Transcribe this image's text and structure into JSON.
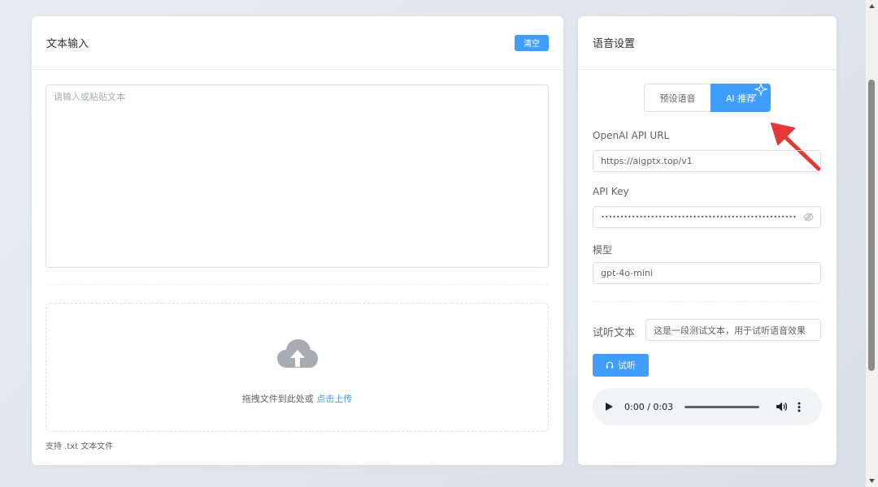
{
  "text_input": {
    "title": "文本输入",
    "clear_label": "清空",
    "placeholder": "请输入或粘贴文本",
    "upload_text": "拖拽文件到此处或 ",
    "upload_link": "点击上传",
    "upload_tip": "支持 .txt 文本文件"
  },
  "voice_settings": {
    "title": "语音设置",
    "segment": {
      "preset_label": "预设语音",
      "ai_label": "AI 推荐",
      "selected": "AI 推荐"
    },
    "api_url_label": "OpenAI API URL",
    "api_url_value": "https://aigptx.top/v1",
    "api_key_label": "API Key",
    "api_key_value": "•••••••••••••••••••••••••••••••••••••••••••••••••••",
    "model_label": "模型",
    "model_value": "gpt-4o-mini",
    "trial_label": "试听文本",
    "trial_value": "这是一段测试文本，用于试听语音效果",
    "listen_label": "试听",
    "audio_time": "0:00 / 0:03"
  },
  "colors": {
    "accent": "#409eff",
    "annotation_arrow": "#e53935"
  }
}
